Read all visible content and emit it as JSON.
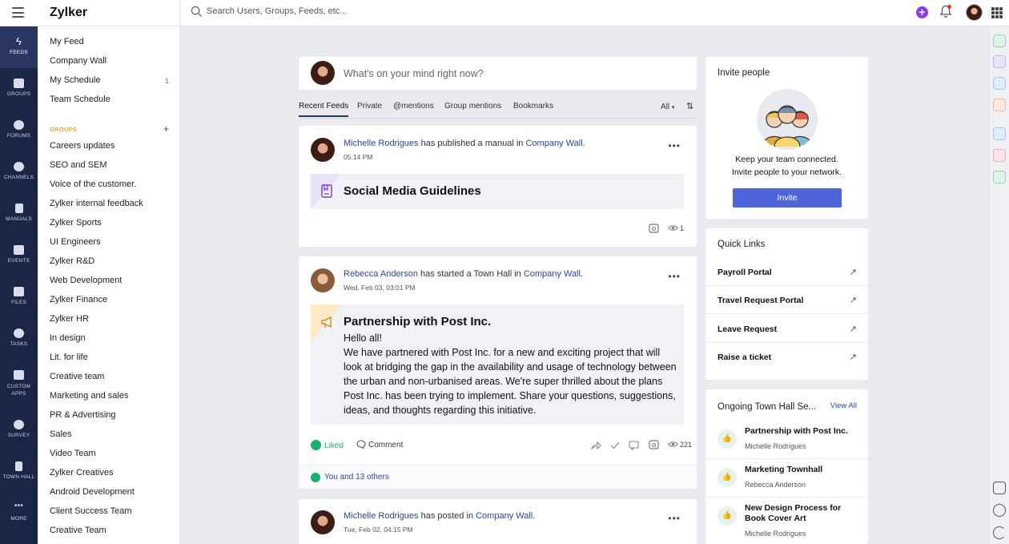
{
  "app": {
    "name": "Zylker"
  },
  "search": {
    "placeholder": "Search Users, Groups, Feeds, etc..."
  },
  "rail": [
    "FEEDS",
    "GROUPS",
    "FORUMS",
    "CHANNELS",
    "MANUALS",
    "EVENTS",
    "FILES",
    "TASKS",
    "CUSTOM APPS",
    "SURVEY",
    "TOWN HALL",
    "MORE"
  ],
  "nav": {
    "top": [
      {
        "label": "My Feed"
      },
      {
        "label": "Company Wall"
      },
      {
        "label": "My Schedule",
        "badge": "1"
      },
      {
        "label": "Team Schedule"
      }
    ],
    "groups_header": "GROUPS",
    "groups_add": "+",
    "groups": [
      "Careers updates",
      "SEO and SEM",
      "Voice of the customer.",
      "Zylker internal feedback",
      "Zylker Sports",
      "UI Engineers",
      "Zylker R&D",
      "Web Development",
      "Zylker Finance",
      "Zylker HR",
      "In design",
      "Lit. for life",
      "Creative team",
      "Marketing and sales",
      "PR & Advertising",
      "Sales",
      "Video Team",
      "Zylker Creatives",
      "Android Development",
      "Client Success Team",
      "Creative Team"
    ]
  },
  "composer": {
    "placeholder": "What's on your mind right now?"
  },
  "tabs": {
    "items": [
      "Recent Feeds",
      "Private",
      "@mentions",
      "Group mentions",
      "Bookmarks"
    ],
    "filter": "All",
    "filter_caret": "▾",
    "sort_icon": "⇅"
  },
  "posts": [
    {
      "author": "Michelle Rodrigues",
      "action": " has published a manual in ",
      "target": "Company Wall",
      "end": ".",
      "time": "05:14 PM",
      "content_title": "Social Media Guidelines",
      "views": "1"
    },
    {
      "author": "Rebecca Anderson",
      "action": " has started a Town Hall in ",
      "target": "Company Wall",
      "end": ".",
      "time": "Wed, Feb 03, 03:01 PM",
      "content_title": "Partnership with Post Inc.",
      "greeting": "Hello all!",
      "body": "We have partnered with Post Inc. for a new and exciting project that will look at bridging the gap in the availability and usage of technology between the urban and non-urbanised areas. We're super thrilled about the plans Post Inc. has been trying to implement. Share your questions, suggestions, ideas, and thoughts regarding this initiative.",
      "like_label": "Liked",
      "comment_label": "Comment",
      "views": "221",
      "likes_summary": "You and 13 others"
    },
    {
      "author": "Michelle Rodrigues",
      "action": " has posted in ",
      "target": "Company Wall",
      "end": ".",
      "time": "Tue, Feb 02, 04:15 PM"
    }
  ],
  "invite": {
    "title": "Invite people",
    "line1": "Keep your team connected.",
    "line2": "Invite people to your network.",
    "button": "Invite"
  },
  "quick_links": {
    "title": "Quick Links",
    "items": [
      "Payroll Portal",
      "Travel Request Portal",
      "Leave Request",
      "Raise a ticket"
    ],
    "arrow": "↗"
  },
  "townhall": {
    "title": "Ongoing Town Hall Se...",
    "view_all": "View All",
    "items": [
      {
        "title": "Partnership with Post Inc.",
        "author": "Michelle Rodrigues"
      },
      {
        "title": "Marketing Townhall",
        "author": "Rebecca Anderson"
      },
      {
        "title": "New Design Process for Book Cover Art",
        "author": "Michelle Rodrigues"
      }
    ]
  },
  "colors": {
    "accent": "#4e64d9",
    "rail": "#1b2546",
    "groups": "#f39c3a",
    "liked": "#1ab26b",
    "link": "#2b44a8"
  }
}
